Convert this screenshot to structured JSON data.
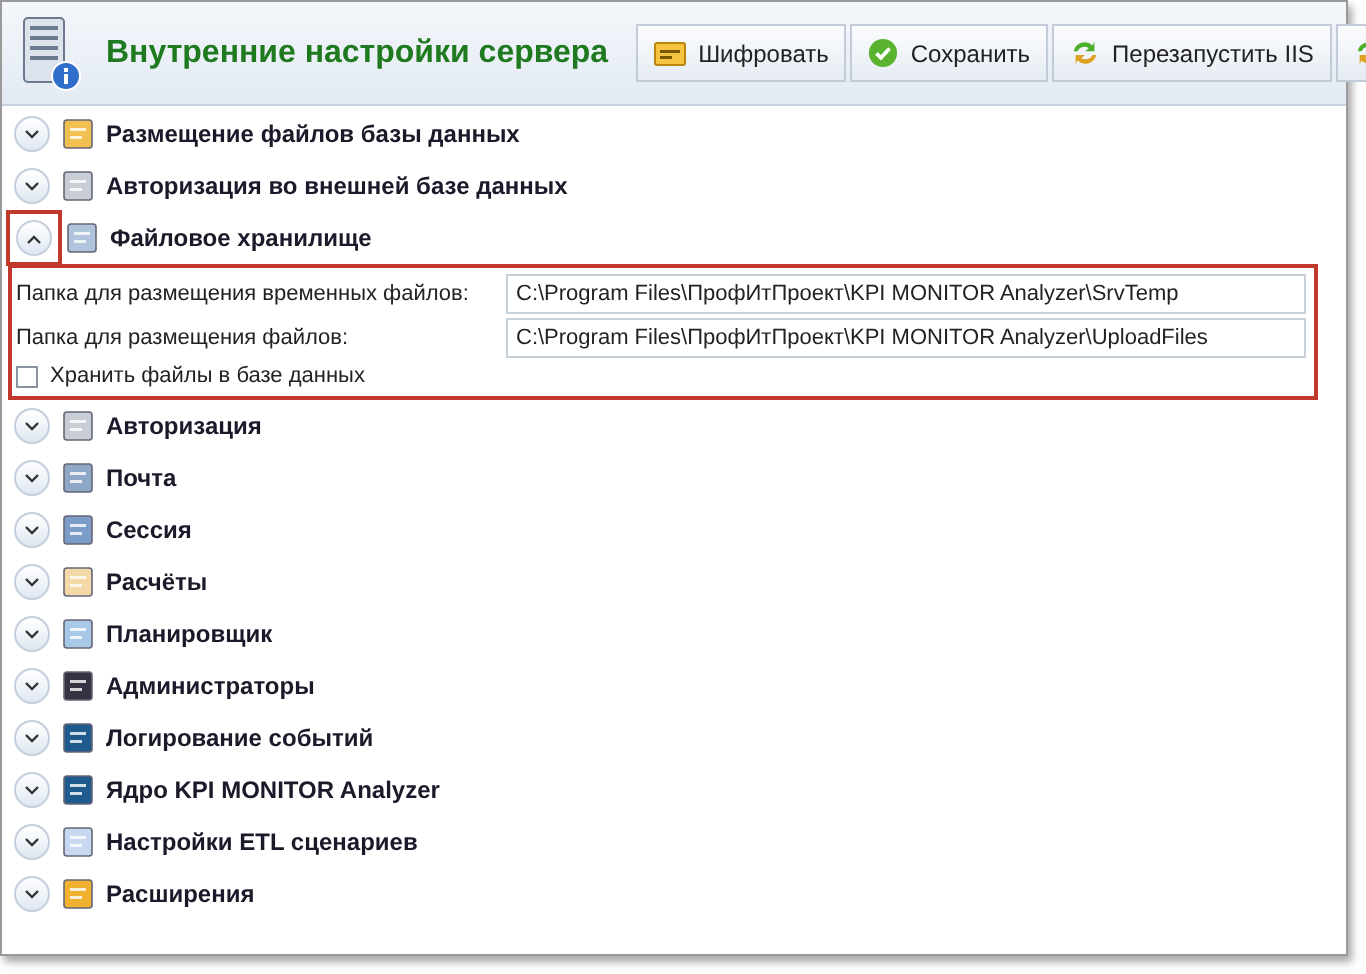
{
  "header": {
    "title": "Внутренние настройки сервера",
    "buttons": [
      {
        "label": "Шифровать",
        "kind": "key"
      },
      {
        "label": "Сохранить",
        "kind": "check"
      },
      {
        "label": "Перезапустить IIS",
        "kind": "refresh"
      },
      {
        "kind": "refresh"
      }
    ]
  },
  "sections": [
    {
      "title": "Размещение файлов базы данных",
      "expanded": false
    },
    {
      "title": "Авторизация во внешней базе данных",
      "expanded": false
    },
    {
      "title": "Файловое хранилище",
      "expanded": true,
      "highlighted": true,
      "fields": [
        {
          "label": "Папка для размещения временных файлов:",
          "value": "C:\\Program Files\\ПрофИтПроект\\KPI MONITOR Analyzer\\SrvTemp"
        },
        {
          "label": "Папка для размещения файлов:",
          "value": "C:\\Program Files\\ПрофИтПроект\\KPI MONITOR Analyzer\\UploadFiles"
        }
      ],
      "checkbox": {
        "label": "Хранить файлы в базе данных",
        "checked": false
      }
    },
    {
      "title": "Авторизация",
      "expanded": false
    },
    {
      "title": "Почта",
      "expanded": false
    },
    {
      "title": "Сессия",
      "expanded": false
    },
    {
      "title": "Расчёты",
      "expanded": false
    },
    {
      "title": "Планировщик",
      "expanded": false
    },
    {
      "title": "Администраторы",
      "expanded": false
    },
    {
      "title": "Логирование событий",
      "expanded": false
    },
    {
      "title": "Ядро KPI MONITOR Analyzer",
      "expanded": false
    },
    {
      "title": "Настройки ETL сценариев",
      "expanded": false
    },
    {
      "title": "Расширения",
      "expanded": false
    }
  ]
}
